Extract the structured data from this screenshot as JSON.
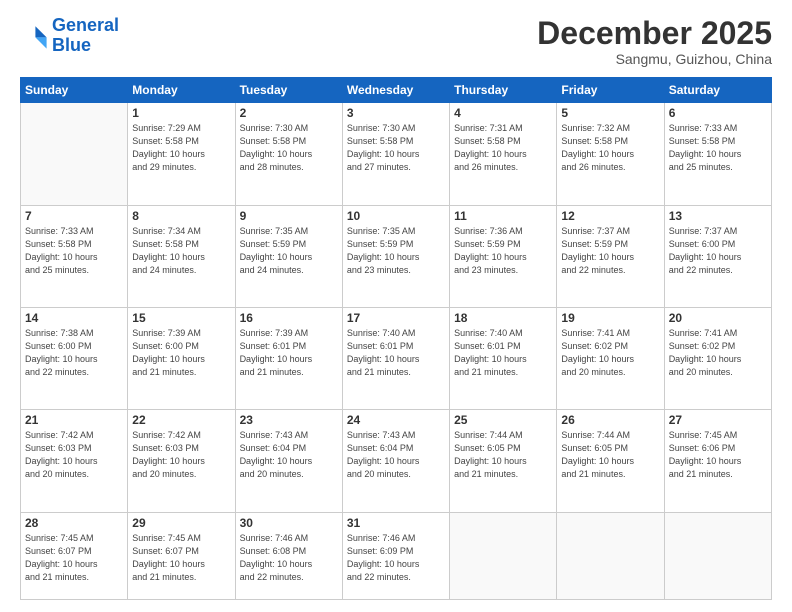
{
  "logo": {
    "line1": "General",
    "line2": "Blue"
  },
  "header": {
    "month": "December 2025",
    "location": "Sangmu, Guizhou, China"
  },
  "weekdays": [
    "Sunday",
    "Monday",
    "Tuesday",
    "Wednesday",
    "Thursday",
    "Friday",
    "Saturday"
  ],
  "weeks": [
    [
      {
        "day": "",
        "info": ""
      },
      {
        "day": "1",
        "info": "Sunrise: 7:29 AM\nSunset: 5:58 PM\nDaylight: 10 hours\nand 29 minutes."
      },
      {
        "day": "2",
        "info": "Sunrise: 7:30 AM\nSunset: 5:58 PM\nDaylight: 10 hours\nand 28 minutes."
      },
      {
        "day": "3",
        "info": "Sunrise: 7:30 AM\nSunset: 5:58 PM\nDaylight: 10 hours\nand 27 minutes."
      },
      {
        "day": "4",
        "info": "Sunrise: 7:31 AM\nSunset: 5:58 PM\nDaylight: 10 hours\nand 26 minutes."
      },
      {
        "day": "5",
        "info": "Sunrise: 7:32 AM\nSunset: 5:58 PM\nDaylight: 10 hours\nand 26 minutes."
      },
      {
        "day": "6",
        "info": "Sunrise: 7:33 AM\nSunset: 5:58 PM\nDaylight: 10 hours\nand 25 minutes."
      }
    ],
    [
      {
        "day": "7",
        "info": "Sunrise: 7:33 AM\nSunset: 5:58 PM\nDaylight: 10 hours\nand 25 minutes."
      },
      {
        "day": "8",
        "info": "Sunrise: 7:34 AM\nSunset: 5:58 PM\nDaylight: 10 hours\nand 24 minutes."
      },
      {
        "day": "9",
        "info": "Sunrise: 7:35 AM\nSunset: 5:59 PM\nDaylight: 10 hours\nand 24 minutes."
      },
      {
        "day": "10",
        "info": "Sunrise: 7:35 AM\nSunset: 5:59 PM\nDaylight: 10 hours\nand 23 minutes."
      },
      {
        "day": "11",
        "info": "Sunrise: 7:36 AM\nSunset: 5:59 PM\nDaylight: 10 hours\nand 23 minutes."
      },
      {
        "day": "12",
        "info": "Sunrise: 7:37 AM\nSunset: 5:59 PM\nDaylight: 10 hours\nand 22 minutes."
      },
      {
        "day": "13",
        "info": "Sunrise: 7:37 AM\nSunset: 6:00 PM\nDaylight: 10 hours\nand 22 minutes."
      }
    ],
    [
      {
        "day": "14",
        "info": "Sunrise: 7:38 AM\nSunset: 6:00 PM\nDaylight: 10 hours\nand 22 minutes."
      },
      {
        "day": "15",
        "info": "Sunrise: 7:39 AM\nSunset: 6:00 PM\nDaylight: 10 hours\nand 21 minutes."
      },
      {
        "day": "16",
        "info": "Sunrise: 7:39 AM\nSunset: 6:01 PM\nDaylight: 10 hours\nand 21 minutes."
      },
      {
        "day": "17",
        "info": "Sunrise: 7:40 AM\nSunset: 6:01 PM\nDaylight: 10 hours\nand 21 minutes."
      },
      {
        "day": "18",
        "info": "Sunrise: 7:40 AM\nSunset: 6:01 PM\nDaylight: 10 hours\nand 21 minutes."
      },
      {
        "day": "19",
        "info": "Sunrise: 7:41 AM\nSunset: 6:02 PM\nDaylight: 10 hours\nand 20 minutes."
      },
      {
        "day": "20",
        "info": "Sunrise: 7:41 AM\nSunset: 6:02 PM\nDaylight: 10 hours\nand 20 minutes."
      }
    ],
    [
      {
        "day": "21",
        "info": "Sunrise: 7:42 AM\nSunset: 6:03 PM\nDaylight: 10 hours\nand 20 minutes."
      },
      {
        "day": "22",
        "info": "Sunrise: 7:42 AM\nSunset: 6:03 PM\nDaylight: 10 hours\nand 20 minutes."
      },
      {
        "day": "23",
        "info": "Sunrise: 7:43 AM\nSunset: 6:04 PM\nDaylight: 10 hours\nand 20 minutes."
      },
      {
        "day": "24",
        "info": "Sunrise: 7:43 AM\nSunset: 6:04 PM\nDaylight: 10 hours\nand 20 minutes."
      },
      {
        "day": "25",
        "info": "Sunrise: 7:44 AM\nSunset: 6:05 PM\nDaylight: 10 hours\nand 21 minutes."
      },
      {
        "day": "26",
        "info": "Sunrise: 7:44 AM\nSunset: 6:05 PM\nDaylight: 10 hours\nand 21 minutes."
      },
      {
        "day": "27",
        "info": "Sunrise: 7:45 AM\nSunset: 6:06 PM\nDaylight: 10 hours\nand 21 minutes."
      }
    ],
    [
      {
        "day": "28",
        "info": "Sunrise: 7:45 AM\nSunset: 6:07 PM\nDaylight: 10 hours\nand 21 minutes."
      },
      {
        "day": "29",
        "info": "Sunrise: 7:45 AM\nSunset: 6:07 PM\nDaylight: 10 hours\nand 21 minutes."
      },
      {
        "day": "30",
        "info": "Sunrise: 7:46 AM\nSunset: 6:08 PM\nDaylight: 10 hours\nand 22 minutes."
      },
      {
        "day": "31",
        "info": "Sunrise: 7:46 AM\nSunset: 6:09 PM\nDaylight: 10 hours\nand 22 minutes."
      },
      {
        "day": "",
        "info": ""
      },
      {
        "day": "",
        "info": ""
      },
      {
        "day": "",
        "info": ""
      }
    ]
  ]
}
